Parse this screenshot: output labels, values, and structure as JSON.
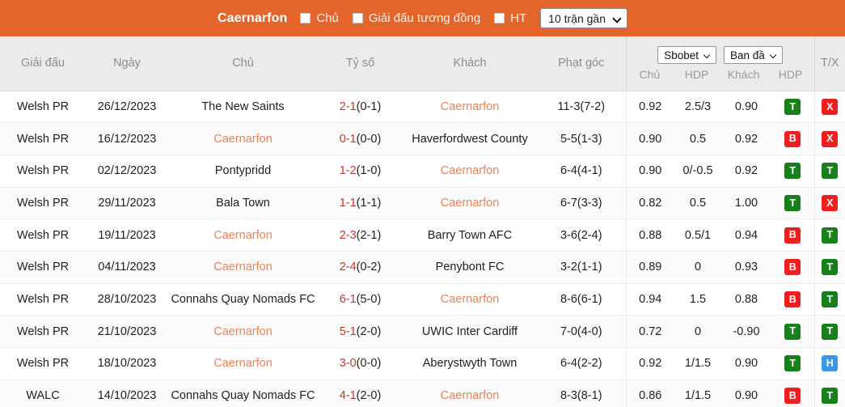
{
  "topbar": {
    "team_name": "Caernarfon",
    "filters": [
      {
        "label": "Chủ",
        "checked": false,
        "icon": "checkbox-unchecked-icon"
      },
      {
        "label": "Giải đấu tương đồng",
        "checked": false,
        "icon": "checkbox-unchecked-icon"
      },
      {
        "label": "HT",
        "checked": false,
        "icon": "checkbox-unchecked-icon"
      }
    ],
    "range_select": {
      "value": "10 trận gần",
      "icon": "chevron-down-icon"
    },
    "background_color": "#e3652b"
  },
  "table": {
    "headers": {
      "league": "Giải đấu",
      "date": "Ngày",
      "home": "Chủ",
      "score": "Tỷ số",
      "away": "Khách",
      "corners": "Phạt góc",
      "tx": "T/X"
    },
    "odds_group": {
      "bookmaker_select": {
        "value": "Sbobet",
        "icon": "chevron-down-icon"
      },
      "line_select": {
        "value": "Ban đầ",
        "icon": "chevron-down-icon"
      },
      "sublabels": [
        "Chủ",
        "HDP",
        "Khách",
        "HDP"
      ]
    },
    "rows": [
      {
        "league": "Welsh PR",
        "date": "26/12/2023",
        "home": "The New Saints",
        "home_highlight": false,
        "score": "2-1",
        "ht": "(0-1)",
        "away": "Caernarfon",
        "away_highlight": true,
        "corners": "11-3(7-2)",
        "home_odds": "0.92",
        "hdp": "2.5/3",
        "away_odds": "0.90",
        "result_badge": {
          "text": "T",
          "color": "green"
        },
        "tx_badge": {
          "text": "X",
          "color": "red"
        }
      },
      {
        "league": "Welsh PR",
        "date": "16/12/2023",
        "home": "Caernarfon",
        "home_highlight": true,
        "score": "0-1",
        "ht": "(0-0)",
        "away": "Haverfordwest County",
        "away_highlight": false,
        "corners": "5-5(1-3)",
        "home_odds": "0.90",
        "hdp": "0.5",
        "away_odds": "0.92",
        "result_badge": {
          "text": "B",
          "color": "red"
        },
        "tx_badge": {
          "text": "X",
          "color": "red"
        }
      },
      {
        "league": "Welsh PR",
        "date": "02/12/2023",
        "home": "Pontypridd",
        "home_highlight": false,
        "score": "1-2",
        "ht": "(1-0)",
        "away": "Caernarfon",
        "away_highlight": true,
        "corners": "6-4(4-1)",
        "home_odds": "0.90",
        "hdp": "0/-0.5",
        "away_odds": "0.92",
        "result_badge": {
          "text": "T",
          "color": "green"
        },
        "tx_badge": {
          "text": "T",
          "color": "green"
        }
      },
      {
        "league": "Welsh PR",
        "date": "29/11/2023",
        "home": "Bala Town",
        "home_highlight": false,
        "score": "1-1",
        "ht": "(1-1)",
        "away": "Caernarfon",
        "away_highlight": true,
        "corners": "6-7(3-3)",
        "home_odds": "0.82",
        "hdp": "0.5",
        "away_odds": "1.00",
        "result_badge": {
          "text": "T",
          "color": "green"
        },
        "tx_badge": {
          "text": "X",
          "color": "red"
        }
      },
      {
        "league": "Welsh PR",
        "date": "19/11/2023",
        "home": "Caernarfon",
        "home_highlight": true,
        "score": "2-3",
        "ht": "(2-1)",
        "away": "Barry Town AFC",
        "away_highlight": false,
        "corners": "3-6(2-4)",
        "home_odds": "0.88",
        "hdp": "0.5/1",
        "away_odds": "0.94",
        "result_badge": {
          "text": "B",
          "color": "red"
        },
        "tx_badge": {
          "text": "T",
          "color": "green"
        }
      },
      {
        "league": "Welsh PR",
        "date": "04/11/2023",
        "home": "Caernarfon",
        "home_highlight": true,
        "score": "2-4",
        "ht": "(0-2)",
        "away": "Penybont FC",
        "away_highlight": false,
        "corners": "3-2(1-1)",
        "home_odds": "0.89",
        "hdp": "0",
        "away_odds": "0.93",
        "result_badge": {
          "text": "B",
          "color": "red"
        },
        "tx_badge": {
          "text": "T",
          "color": "green"
        }
      },
      {
        "league": "Welsh PR",
        "date": "28/10/2023",
        "home": "Connahs Quay Nomads FC",
        "home_highlight": false,
        "score": "6-1",
        "ht": "(5-0)",
        "away": "Caernarfon",
        "away_highlight": true,
        "corners": "8-6(6-1)",
        "home_odds": "0.94",
        "hdp": "1.5",
        "away_odds": "0.88",
        "result_badge": {
          "text": "B",
          "color": "red"
        },
        "tx_badge": {
          "text": "T",
          "color": "green"
        }
      },
      {
        "league": "Welsh PR",
        "date": "21/10/2023",
        "home": "Caernarfon",
        "home_highlight": true,
        "score": "5-1",
        "ht": "(2-0)",
        "away": "UWIC Inter Cardiff",
        "away_highlight": false,
        "corners": "7-0(4-0)",
        "home_odds": "0.72",
        "hdp": "0",
        "away_odds": "-0.90",
        "result_badge": {
          "text": "T",
          "color": "green"
        },
        "tx_badge": {
          "text": "T",
          "color": "green"
        }
      },
      {
        "league": "Welsh PR",
        "date": "18/10/2023",
        "home": "Caernarfon",
        "home_highlight": true,
        "score": "3-0",
        "ht": "(0-0)",
        "away": "Aberystwyth Town",
        "away_highlight": false,
        "corners": "6-4(2-2)",
        "home_odds": "0.92",
        "hdp": "1/1.5",
        "away_odds": "0.90",
        "result_badge": {
          "text": "T",
          "color": "green"
        },
        "tx_badge": {
          "text": "H",
          "color": "blue"
        }
      },
      {
        "league": "WALC",
        "date": "14/10/2023",
        "home": "Connahs Quay Nomads FC",
        "home_highlight": false,
        "score": "4-1",
        "ht": "(2-0)",
        "away": "Caernarfon",
        "away_highlight": true,
        "corners": "8-3(8-1)",
        "home_odds": "0.86",
        "hdp": "1/1.5",
        "away_odds": "0.90",
        "result_badge": {
          "text": "B",
          "color": "red"
        },
        "tx_badge": {
          "text": "T",
          "color": "green"
        }
      }
    ]
  },
  "colors": {
    "accent_orange": "#e3652b",
    "highlight_team": "#e8845a",
    "score_red": "#c0392b",
    "badge_green": "#17801a",
    "badge_red": "#ef1f1f",
    "badge_blue": "#3d97e8"
  }
}
